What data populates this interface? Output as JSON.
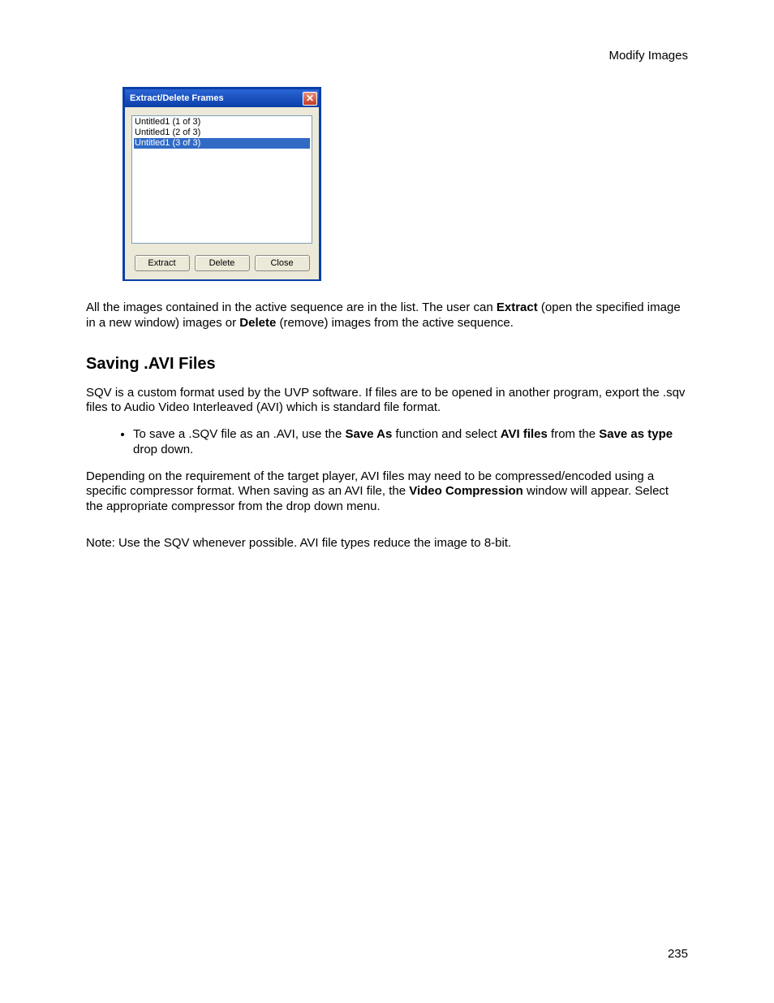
{
  "header": "Modify Images",
  "dialog": {
    "title": "Extract/Delete Frames",
    "items": [
      {
        "label": "Untitled1 (1 of 3)",
        "selected": false
      },
      {
        "label": "Untitled1 (2 of 3)",
        "selected": false
      },
      {
        "label": "Untitled1 (3 of 3)",
        "selected": true
      }
    ],
    "buttons": {
      "extract": "Extract",
      "delete": "Delete",
      "close": "Close"
    },
    "closeX": "✕"
  },
  "para1": {
    "t1": "All the images contained in the active sequence are in the list. The user can ",
    "b1": "Extract",
    "t2": " (open the specified image in a new window) images or ",
    "b2": "Delete",
    "t3": " (remove) images from the active sequence."
  },
  "heading": "Saving .AVI Files",
  "para2": "SQV is a custom format used by the UVP software. If files are to be opened in another program, export the .sqv files to Audio Video Interleaved (AVI) which is standard file format.",
  "bullet1": {
    "t1": "To save a .SQV file as an .AVI, use the ",
    "b1": "Save As",
    "t2": " function and select ",
    "b2": "AVI files",
    "t3": " from the ",
    "b3": "Save as type",
    "t4": " drop down."
  },
  "para3": {
    "t1": "Depending on the requirement of the target player, AVI files may need to be compressed/encoded using a specific compressor format. When saving as an AVI file, the ",
    "b1": "Video Compression",
    "t2": " window will appear. Select the appropriate compressor from the drop down menu."
  },
  "note": "Note: Use the SQV whenever possible. AVI file types reduce the image to 8-bit.",
  "pageNumber": "235"
}
